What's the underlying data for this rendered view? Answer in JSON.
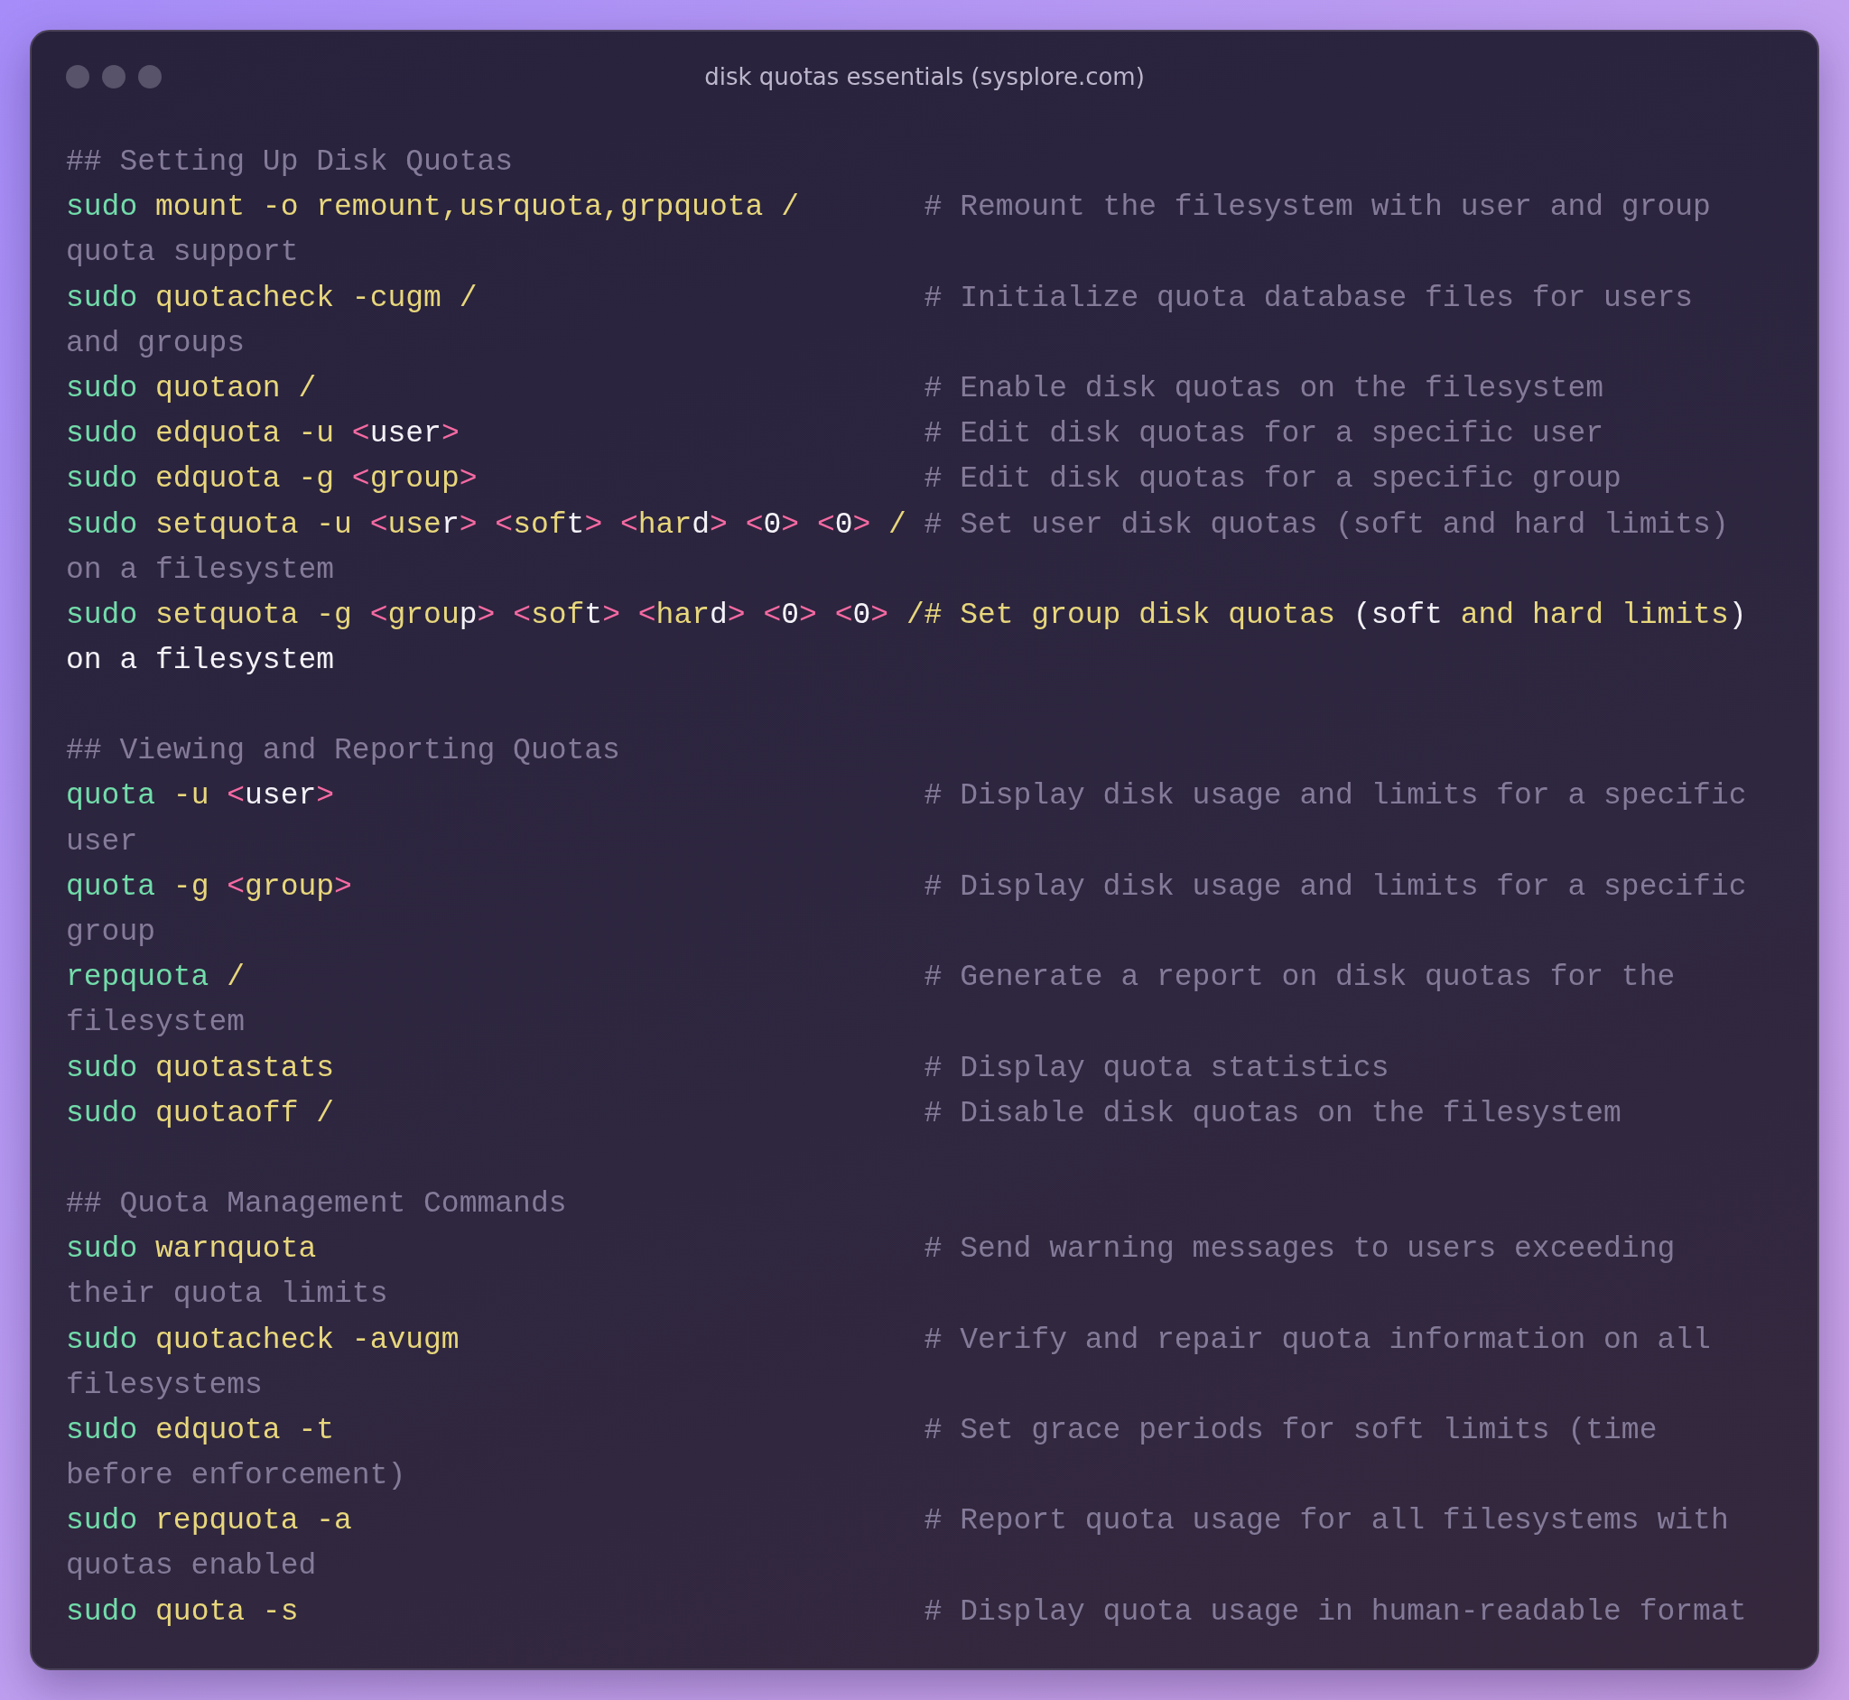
{
  "window": {
    "title": "disk quotas essentials (sysplore.com)"
  },
  "sections": [
    {
      "heading": "## Setting Up Disk Quotas",
      "lines": [
        {
          "code": [
            {
              "kind": "cmd",
              "text": "sudo"
            },
            {
              "kind": "arg",
              "text": " mount -o remount,usrquota,grpquota /"
            }
          ],
          "comment": [
            {
              "kind": "comment",
              "text": "# Remount the filesystem with user and group"
            }
          ],
          "wrap": [
            {
              "kind": "comment",
              "text": "quota support"
            }
          ]
        },
        {
          "code": [
            {
              "kind": "cmd",
              "text": "sudo"
            },
            {
              "kind": "arg",
              "text": " quotacheck -cugm /"
            }
          ],
          "comment": [
            {
              "kind": "comment",
              "text": "# Initialize quota database files for users"
            }
          ],
          "wrap": [
            {
              "kind": "comment",
              "text": "and groups"
            }
          ]
        },
        {
          "code": [
            {
              "kind": "cmd",
              "text": "sudo"
            },
            {
              "kind": "arg",
              "text": " quotaon /"
            }
          ],
          "comment": [
            {
              "kind": "comment",
              "text": "# Enable disk quotas on the filesystem"
            }
          ]
        },
        {
          "code": [
            {
              "kind": "cmd",
              "text": "sudo"
            },
            {
              "kind": "arg",
              "text": " edquota -u "
            },
            {
              "kind": "tag",
              "text": "<"
            },
            {
              "kind": "plain",
              "text": "user"
            },
            {
              "kind": "tag",
              "text": ">"
            }
          ],
          "comment": [
            {
              "kind": "comment",
              "text": "# Edit disk quotas for a specific user"
            }
          ]
        },
        {
          "code": [
            {
              "kind": "cmd",
              "text": "sudo"
            },
            {
              "kind": "arg",
              "text": " edquota -g "
            },
            {
              "kind": "tag",
              "text": "<"
            },
            {
              "kind": "arg",
              "text": "group"
            },
            {
              "kind": "tag",
              "text": ">"
            }
          ],
          "comment": [
            {
              "kind": "comment",
              "text": "# Edit disk quotas for a specific group"
            }
          ]
        },
        {
          "code": [
            {
              "kind": "cmd",
              "text": "sudo"
            },
            {
              "kind": "arg",
              "text": " setquota -u "
            },
            {
              "kind": "tag",
              "text": "<"
            },
            {
              "kind": "arg",
              "text": "use"
            },
            {
              "kind": "plain",
              "text": "r"
            },
            {
              "kind": "tag",
              "text": ">"
            },
            {
              "kind": "tag",
              "text": " <"
            },
            {
              "kind": "arg",
              "text": "sof"
            },
            {
              "kind": "plain",
              "text": "t"
            },
            {
              "kind": "tag",
              "text": ">"
            },
            {
              "kind": "tag",
              "text": " <"
            },
            {
              "kind": "arg",
              "text": "har"
            },
            {
              "kind": "plain",
              "text": "d"
            },
            {
              "kind": "tag",
              "text": ">"
            },
            {
              "kind": "tag",
              "text": " <"
            },
            {
              "kind": "plain",
              "text": "0"
            },
            {
              "kind": "tag",
              "text": ">"
            },
            {
              "kind": "tag",
              "text": " <"
            },
            {
              "kind": "plain",
              "text": "0"
            },
            {
              "kind": "tag",
              "text": ">"
            },
            {
              "kind": "arg",
              "text": " /"
            }
          ],
          "comment": [
            {
              "kind": "comment",
              "text": "# Set user disk quotas (soft and hard limits)"
            }
          ],
          "wrap": [
            {
              "kind": "comment",
              "text": "on a filesystem"
            }
          ]
        },
        {
          "code": [
            {
              "kind": "cmd",
              "text": "sudo"
            },
            {
              "kind": "arg",
              "text": " setquota -g "
            },
            {
              "kind": "tag",
              "text": "<"
            },
            {
              "kind": "arg",
              "text": "grou"
            },
            {
              "kind": "plain",
              "text": "p"
            },
            {
              "kind": "tag",
              "text": ">"
            },
            {
              "kind": "tag",
              "text": " <"
            },
            {
              "kind": "arg",
              "text": "sof"
            },
            {
              "kind": "plain",
              "text": "t"
            },
            {
              "kind": "tag",
              "text": ">"
            },
            {
              "kind": "tag",
              "text": " <"
            },
            {
              "kind": "arg",
              "text": "har"
            },
            {
              "kind": "plain",
              "text": "d"
            },
            {
              "kind": "tag",
              "text": ">"
            },
            {
              "kind": "tag",
              "text": " <"
            },
            {
              "kind": "plain",
              "text": "0"
            },
            {
              "kind": "tag",
              "text": ">"
            },
            {
              "kind": "tag",
              "text": " <"
            },
            {
              "kind": "plain",
              "text": "0"
            },
            {
              "kind": "tag",
              "text": ">"
            },
            {
              "kind": "arg",
              "text": " /"
            }
          ],
          "comment": [
            {
              "kind": "arg",
              "text": "# Set group disk quotas"
            },
            {
              "kind": "plain",
              "text": " (soft"
            },
            {
              "kind": "arg",
              "text": " and hard limits"
            },
            {
              "kind": "plain",
              "text": ")"
            }
          ],
          "wrap": [
            {
              "kind": "plain",
              "text": "on a filesystem"
            }
          ]
        }
      ]
    },
    {
      "heading": "## Viewing and Reporting Quotas",
      "lines": [
        {
          "code": [
            {
              "kind": "cmd",
              "text": "quota"
            },
            {
              "kind": "arg",
              "text": " -u "
            },
            {
              "kind": "tag",
              "text": "<"
            },
            {
              "kind": "plain",
              "text": "user"
            },
            {
              "kind": "tag",
              "text": ">"
            }
          ],
          "comment": [
            {
              "kind": "comment",
              "text": "# Display disk usage and limits for a specific"
            }
          ],
          "wrap": [
            {
              "kind": "comment",
              "text": "user"
            }
          ]
        },
        {
          "code": [
            {
              "kind": "cmd",
              "text": "quota"
            },
            {
              "kind": "arg",
              "text": " -g "
            },
            {
              "kind": "tag",
              "text": "<"
            },
            {
              "kind": "arg",
              "text": "group"
            },
            {
              "kind": "tag",
              "text": ">"
            }
          ],
          "comment": [
            {
              "kind": "comment",
              "text": "# Display disk usage and limits for a specific"
            }
          ],
          "wrap": [
            {
              "kind": "comment",
              "text": "group"
            }
          ]
        },
        {
          "code": [
            {
              "kind": "cmd",
              "text": "repquota"
            },
            {
              "kind": "arg",
              "text": " /"
            }
          ],
          "comment": [
            {
              "kind": "comment",
              "text": "# Generate a report on disk quotas for the"
            }
          ],
          "wrap": [
            {
              "kind": "comment",
              "text": "filesystem"
            }
          ]
        },
        {
          "code": [
            {
              "kind": "cmd",
              "text": "sudo"
            },
            {
              "kind": "arg",
              "text": " quotastats"
            }
          ],
          "comment": [
            {
              "kind": "comment",
              "text": "# Display quota statistics"
            }
          ]
        },
        {
          "code": [
            {
              "kind": "cmd",
              "text": "sudo"
            },
            {
              "kind": "arg",
              "text": " quotaoff /"
            }
          ],
          "comment": [
            {
              "kind": "comment",
              "text": "# Disable disk quotas on the filesystem"
            }
          ]
        }
      ]
    },
    {
      "heading": "## Quota Management Commands",
      "lines": [
        {
          "code": [
            {
              "kind": "cmd",
              "text": "sudo"
            },
            {
              "kind": "arg",
              "text": " warnquota"
            }
          ],
          "comment": [
            {
              "kind": "comment",
              "text": "# Send warning messages to users exceeding"
            }
          ],
          "wrap": [
            {
              "kind": "comment",
              "text": "their quota limits"
            }
          ]
        },
        {
          "code": [
            {
              "kind": "cmd",
              "text": "sudo"
            },
            {
              "kind": "arg",
              "text": " quotacheck -avugm"
            }
          ],
          "comment": [
            {
              "kind": "comment",
              "text": "# Verify and repair quota information on all"
            }
          ],
          "wrap": [
            {
              "kind": "comment",
              "text": "filesystems"
            }
          ]
        },
        {
          "code": [
            {
              "kind": "cmd",
              "text": "sudo"
            },
            {
              "kind": "arg",
              "text": " edquota -t"
            }
          ],
          "comment": [
            {
              "kind": "comment",
              "text": "# Set grace periods for soft limits (time"
            }
          ],
          "wrap": [
            {
              "kind": "comment",
              "text": "before enforcement)"
            }
          ]
        },
        {
          "code": [
            {
              "kind": "cmd",
              "text": "sudo"
            },
            {
              "kind": "arg",
              "text": " repquota -a"
            }
          ],
          "comment": [
            {
              "kind": "comment",
              "text": "# Report quota usage for all filesystems with"
            }
          ],
          "wrap": [
            {
              "kind": "comment",
              "text": "quotas enabled"
            }
          ]
        },
        {
          "code": [
            {
              "kind": "cmd",
              "text": "sudo"
            },
            {
              "kind": "arg",
              "text": " quota -s"
            }
          ],
          "comment": [
            {
              "kind": "comment",
              "text": "# Display quota usage in human-readable format"
            }
          ]
        }
      ]
    }
  ]
}
